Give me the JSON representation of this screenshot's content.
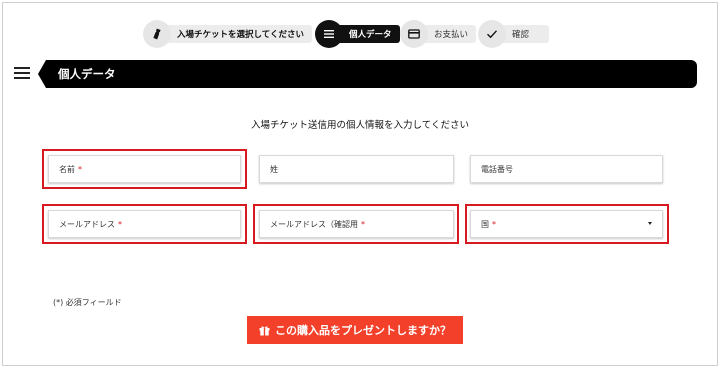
{
  "stepper": {
    "steps": [
      {
        "label": "入場チケットを選択してください",
        "icon": "ticket-icon",
        "state": "done"
      },
      {
        "label": "個人データ",
        "icon": "list-icon",
        "state": "active"
      },
      {
        "label": "お支払い",
        "icon": "credit-card-icon",
        "state": "inactive"
      },
      {
        "label": "確認",
        "icon": "checkmark-icon",
        "state": "inactive"
      }
    ]
  },
  "section": {
    "title": "個人データ",
    "menu_icon": "hamburger-icon"
  },
  "form": {
    "subtitle": "入場チケット送信用の個人情報を入力してください",
    "first_name": {
      "placeholder": "名前",
      "required_mark": "*"
    },
    "last_name": {
      "placeholder": "姓"
    },
    "phone": {
      "placeholder": "電話番号"
    },
    "email": {
      "placeholder": "メールアドレス",
      "required_mark": "*"
    },
    "email_confirm": {
      "placeholder": "メールアドレス（確認用",
      "required_mark": "*"
    },
    "country": {
      "placeholder": "国",
      "required_mark": "*"
    },
    "required_note": "(*)  必須フィールド"
  },
  "gift_button": {
    "label": "この購入品をプレゼントしますか？",
    "icon": "gift-icon"
  },
  "colors": {
    "accent": "#f2402a",
    "highlight": "#d71920",
    "header": "#000000"
  }
}
